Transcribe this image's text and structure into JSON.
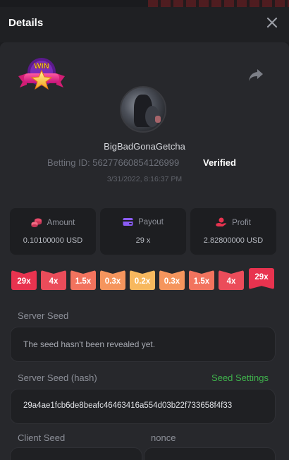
{
  "header": {
    "title": "Details",
    "close_icon": "close-icon"
  },
  "badge": {
    "text": "WIN"
  },
  "player": {
    "username": "BigBadGonaGetcha",
    "betting_id": "Betting ID: 56277660854126999",
    "verified": "Verified",
    "datetime": "3/31/2022, 8:16:37 PM"
  },
  "stats": {
    "amount": {
      "label": "Amount",
      "value": "0.10100000 USD",
      "icon": "coins-icon"
    },
    "payout": {
      "label": "Payout",
      "value": "29 x",
      "icon": "wallet-icon"
    },
    "profit": {
      "label": "Profit",
      "value": "2.82800000 USD",
      "icon": "hand-coin-icon"
    }
  },
  "multipliers": [
    {
      "label": "29x",
      "color": "#e8334f"
    },
    {
      "label": "4x",
      "color": "#eb4c5a"
    },
    {
      "label": "1.5x",
      "color": "#f2735e"
    },
    {
      "label": "0.3x",
      "color": "#f5955d"
    },
    {
      "label": "0.2x",
      "color": "#f7b85e"
    },
    {
      "label": "0.3x",
      "color": "#f5955d"
    },
    {
      "label": "1.5x",
      "color": "#f2735e"
    },
    {
      "label": "4x",
      "color": "#eb4c5a"
    },
    {
      "label": "29x",
      "color": "#e8334f"
    }
  ],
  "server_seed": {
    "label": "Server Seed",
    "value": "The seed hasn't been revealed yet."
  },
  "server_seed_hash": {
    "label": "Server Seed (hash)",
    "link": "Seed Settings",
    "value": "29a4ae1fcb6de8beafc46463416a554d03b22f733658f4f33"
  },
  "client_seed": {
    "label": "Client Seed"
  },
  "nonce": {
    "label": "nonce"
  },
  "colors": {
    "accent_green": "#3fb34c",
    "panel": "#27282c",
    "card": "#1d1e21"
  }
}
